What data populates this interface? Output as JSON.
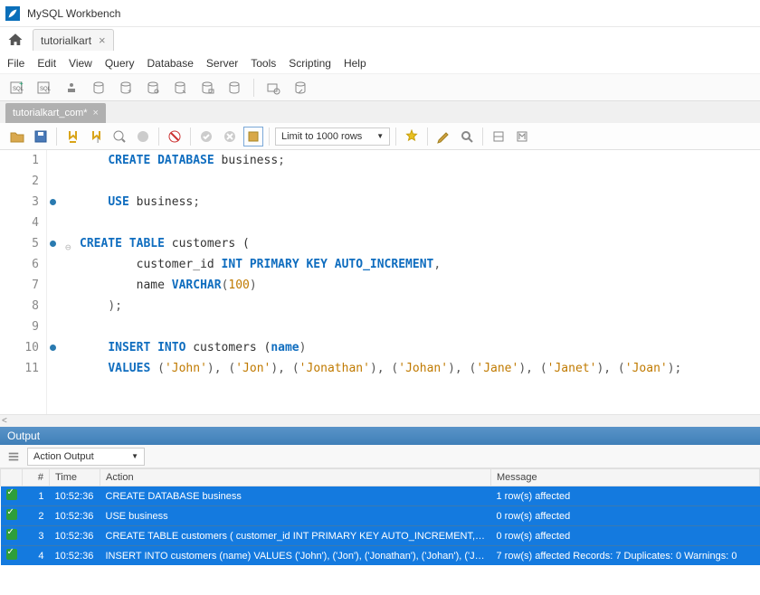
{
  "app_title": "MySQL Workbench",
  "connection_tab": "tutorialkart",
  "menu": [
    "File",
    "Edit",
    "View",
    "Query",
    "Database",
    "Server",
    "Tools",
    "Scripting",
    "Help"
  ],
  "file_tab": "tutorialkart_com*",
  "limit_label": "Limit to 1000 rows",
  "code_lines": [
    {
      "n": 1,
      "marker": false,
      "tokens": [
        [
          "sp",
          "    "
        ],
        [
          "kw",
          "CREATE DATABASE"
        ],
        [
          "sp",
          " "
        ],
        [
          "ident",
          "business"
        ],
        [
          "punc",
          ";"
        ]
      ]
    },
    {
      "n": 2,
      "marker": false,
      "tokens": []
    },
    {
      "n": 3,
      "marker": true,
      "tokens": [
        [
          "sp",
          "    "
        ],
        [
          "kw",
          "USE"
        ],
        [
          "sp",
          " "
        ],
        [
          "ident",
          "business"
        ],
        [
          "punc",
          ";"
        ]
      ]
    },
    {
      "n": 4,
      "marker": false,
      "tokens": []
    },
    {
      "n": 5,
      "marker": true,
      "tokens": [
        [
          "kw",
          "CREATE TABLE"
        ],
        [
          "sp",
          " "
        ],
        [
          "ident",
          "customers ("
        ]
      ]
    },
    {
      "n": 6,
      "marker": false,
      "tokens": [
        [
          "sp",
          "        "
        ],
        [
          "ident",
          "customer_id "
        ],
        [
          "kw",
          "INT PRIMARY KEY AUTO_INCREMENT"
        ],
        [
          "punc",
          ","
        ]
      ]
    },
    {
      "n": 7,
      "marker": false,
      "tokens": [
        [
          "sp",
          "        "
        ],
        [
          "ident",
          "name "
        ],
        [
          "kw",
          "VARCHAR"
        ],
        [
          "punc",
          "("
        ],
        [
          "num",
          "100"
        ],
        [
          "punc",
          ")"
        ]
      ]
    },
    {
      "n": 8,
      "marker": false,
      "tokens": [
        [
          "sp",
          "    "
        ],
        [
          "punc",
          ");"
        ]
      ]
    },
    {
      "n": 9,
      "marker": false,
      "tokens": []
    },
    {
      "n": 10,
      "marker": true,
      "tokens": [
        [
          "sp",
          "    "
        ],
        [
          "kw",
          "INSERT INTO"
        ],
        [
          "sp",
          " "
        ],
        [
          "ident",
          "customers ("
        ],
        [
          "kw",
          "name"
        ],
        [
          "punc",
          ")"
        ]
      ]
    },
    {
      "n": 11,
      "marker": false,
      "tokens": [
        [
          "sp",
          "    "
        ],
        [
          "kw",
          "VALUES"
        ],
        [
          "sp",
          " "
        ],
        [
          "punc",
          "("
        ],
        [
          "str",
          "'John'"
        ],
        [
          "punc",
          "), ("
        ],
        [
          "str",
          "'Jon'"
        ],
        [
          "punc",
          "), ("
        ],
        [
          "str",
          "'Jonathan'"
        ],
        [
          "punc",
          "), ("
        ],
        [
          "str",
          "'Johan'"
        ],
        [
          "punc",
          "), ("
        ],
        [
          "str",
          "'Jane'"
        ],
        [
          "punc",
          "), ("
        ],
        [
          "str",
          "'Janet'"
        ],
        [
          "punc",
          "), ("
        ],
        [
          "str",
          "'Joan'"
        ],
        [
          "punc",
          ");"
        ]
      ]
    }
  ],
  "output_header": "Output",
  "action_output_label": "Action Output",
  "output_columns": {
    "num": "#",
    "time": "Time",
    "action": "Action",
    "message": "Message"
  },
  "output_rows": [
    {
      "n": 1,
      "time": "10:52:36",
      "action": "CREATE DATABASE business",
      "message": "1 row(s) affected"
    },
    {
      "n": 2,
      "time": "10:52:36",
      "action": "USE business",
      "message": "0 row(s) affected"
    },
    {
      "n": 3,
      "time": "10:52:36",
      "action": "CREATE TABLE customers (     customer_id INT PRIMARY KEY AUTO_INCREMENT, ...",
      "message": "0 row(s) affected"
    },
    {
      "n": 4,
      "time": "10:52:36",
      "action": "INSERT INTO customers (name) VALUES ('John'), ('Jon'), ('Jonathan'), ('Johan'), ('Jane')...",
      "message": "7 row(s) affected Records: 7  Duplicates: 0  Warnings: 0"
    }
  ]
}
